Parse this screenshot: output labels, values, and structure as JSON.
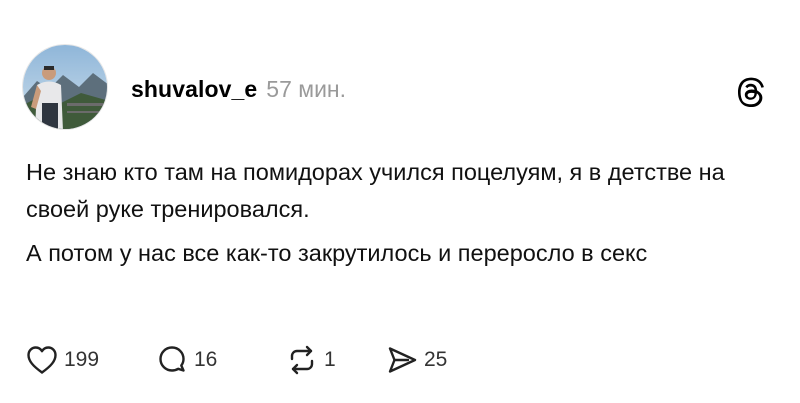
{
  "post": {
    "author": {
      "username": "shuvalov_e",
      "avatar_icon": "profile-photo-mountains"
    },
    "timestamp": "57 мин.",
    "brand_icon": "threads-logo-icon",
    "paragraphs": [
      "Не знаю кто там на помидорах учился поцелуям, я в детстве на своей руке тренировался.",
      "А потом у нас все как-то закрутилось и переросло в секс"
    ],
    "actions": {
      "likes": "199",
      "comments": "16",
      "reposts": "1",
      "shares": "25"
    },
    "colors": {
      "text": "#111111",
      "muted": "#9a9a9a",
      "background": "#ffffff"
    }
  }
}
